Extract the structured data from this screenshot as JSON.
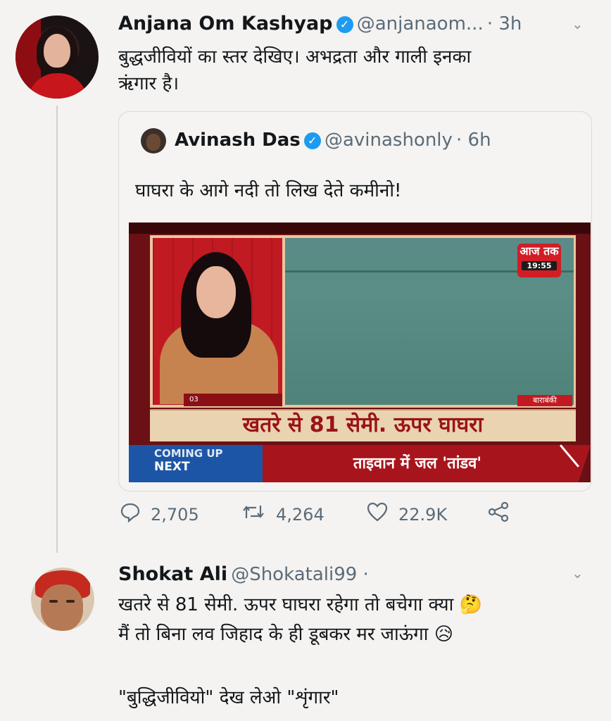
{
  "tweet1": {
    "name": "Anjana Om Kashyap",
    "handle": "@anjanaom...",
    "time": "· 3h",
    "text_line1": "बुद्धजीवियों का स्तर देखिए। अभद्रता और गाली इनका",
    "text_line2": "ऋंगार है।"
  },
  "quote": {
    "name": "Avinash Das",
    "handle": "@avinashonly",
    "time": "· 6h",
    "text": "घाघरा के आगे नदी तो लिख देते कमीनो!",
    "media": {
      "logo_text": "आज तक",
      "clock": "19:55",
      "location": "बाराबंकी",
      "lower_num": "03",
      "headline": "खतरे से 81 सेमी. ऊपर घाघरा",
      "coming_up": "COMING UP",
      "next": "NEXT",
      "ticker": "ताइवान में जल 'तांडव'"
    }
  },
  "actions": {
    "replies": "2,705",
    "retweets": "4,264",
    "likes": "22.9K"
  },
  "tweet2": {
    "name": "Shokat Ali",
    "handle": "@Shokatali99 ·",
    "line1": "खतरे से 81 सेमी. ऊपर घाघरा रहेगा तो बचेगा क्या",
    "line1_emoji": "🤔",
    "line2": "मैं तो बिना लव जिहाद के ही डूबकर मर जाऊंगा",
    "line2_emoji": "😥",
    "line3": "\"बुद्धिजीवियो\" देख लेओ \"शृंगार\""
  },
  "icons": {
    "verified": "verified-badge-icon",
    "chevron": "chevron-down-icon",
    "reply": "reply-icon",
    "retweet": "retweet-icon",
    "like": "heart-icon",
    "share": "share-icon"
  },
  "colors": {
    "verified": "#1d9bf0",
    "handle": "#5b6b78",
    "background": "#f4f3f1"
  }
}
